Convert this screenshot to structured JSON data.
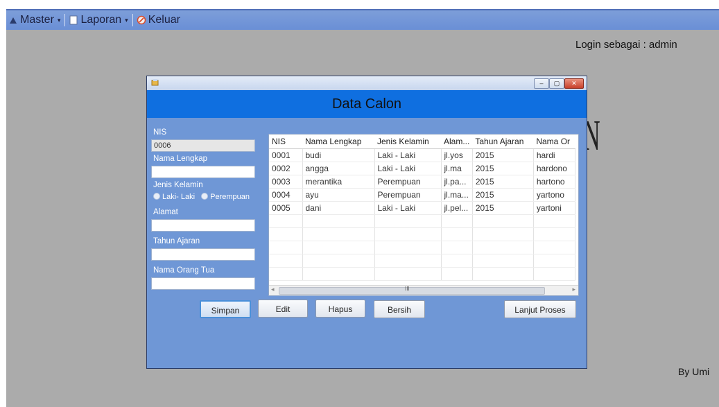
{
  "menu": {
    "items": [
      {
        "label": "Master",
        "icon": "person-icon",
        "has_dropdown": true
      },
      {
        "label": "Laporan",
        "icon": "document-icon",
        "has_dropdown": true
      },
      {
        "label": "Keluar",
        "icon": "exit-icon",
        "has_dropdown": false
      }
    ]
  },
  "login_text": "Login sebagai : admin",
  "credit_text": "By Umi",
  "background_glyph": "N",
  "form": {
    "title": "",
    "header": "Data Calon",
    "window_buttons": {
      "minimize": "–",
      "maximize": "▢",
      "close": "✕"
    },
    "fields": {
      "nis": {
        "label": "NIS",
        "value": "0006"
      },
      "nama_lengkap": {
        "label": "Nama Lengkap",
        "value": ""
      },
      "jenis_kelamin": {
        "label": "Jenis Kelamin",
        "options": [
          "Laki- Laki",
          "Perempuan"
        ]
      },
      "alamat": {
        "label": "Alamat",
        "value": ""
      },
      "tahun_ajaran": {
        "label": "Tahun Ajaran",
        "value": ""
      },
      "nama_orang_tua": {
        "label": "Nama Orang Tua",
        "value": ""
      }
    },
    "grid": {
      "columns": [
        "NIS",
        "Nama Lengkap",
        "Jenis Kelamin",
        "Alam...",
        "Tahun Ajaran",
        "Nama Or"
      ],
      "rows": [
        [
          "0001",
          "budi",
          "Laki - Laki",
          "jl.yos",
          "2015",
          "hardi"
        ],
        [
          "0002",
          "angga",
          "Laki - Laki",
          "jl.ma",
          "2015",
          "hardono"
        ],
        [
          "0003",
          "merantika",
          "Perempuan",
          "jl.pa...",
          "2015",
          "hartono"
        ],
        [
          "0004",
          "ayu",
          "Perempuan",
          "jl.ma...",
          "2015",
          "yartono"
        ],
        [
          "0005",
          "dani",
          "Laki - Laki",
          "jl.pel...",
          "2015",
          "yartoni"
        ]
      ],
      "scroll_grip": "III"
    },
    "buttons": {
      "simpan": "Simpan",
      "edit": "Edit",
      "hapus": "Hapus",
      "bersih": "Bersih",
      "lanjut": "Lanjut Proses"
    }
  },
  "colors": {
    "menubar": "#6a8fd6",
    "desktop": "#ababab",
    "form_body": "#6f97d6",
    "form_header": "#0f6fe0"
  }
}
